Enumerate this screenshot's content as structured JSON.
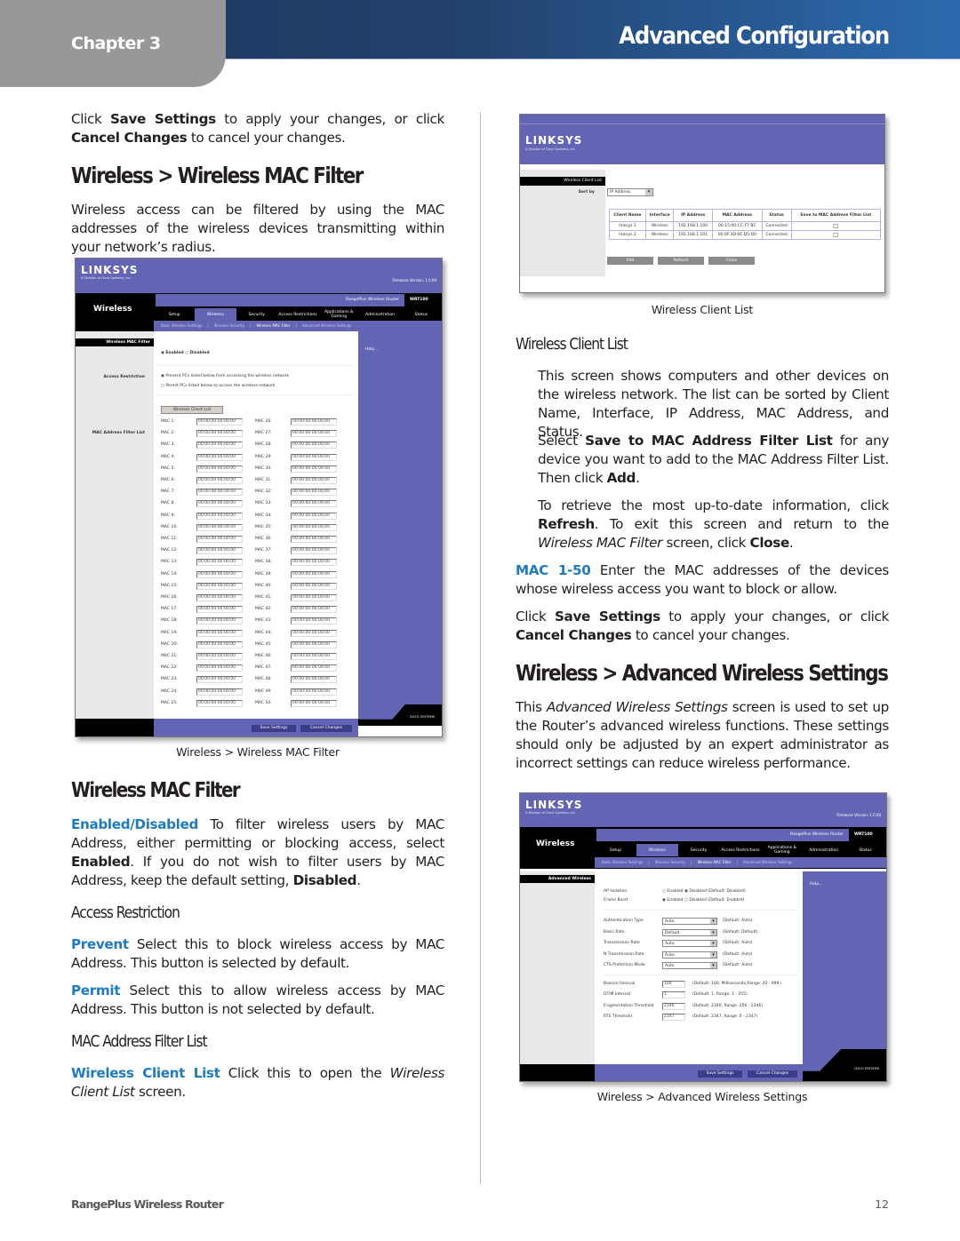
{
  "header": {
    "chapter": "Chapter 3",
    "section": "Advanced Configuration"
  },
  "left": {
    "intro": {
      "pre": "Click ",
      "b1": "Save Settings",
      "mid": " to apply your changes, or click ",
      "b2": "Cancel Changes",
      "post": " to cancel your changes."
    },
    "heading1": "Wireless > Wireless MAC Filter",
    "desc": "Wireless access can be filtered by using the MAC addresses of the wireless devices transmitting within your network’s radius.",
    "caption1": "Wireless > Wireless MAC Filter",
    "heading2": "Wireless MAC Filter",
    "enabled": {
      "term": "Enabled/Disabled",
      "t1": "  To filter wireless users by MAC Address, either permitting or blocking access, select ",
      "b1": "Enabled",
      "t2": ". If you do not wish to filter users by MAC Address, keep the default setting, ",
      "b2": "Disabled",
      "t3": "."
    },
    "sub_access": "Access Restriction",
    "prevent": {
      "term": "Prevent",
      "text": " Select this to block wireless access by MAC Address. This button is selected by default."
    },
    "permit": {
      "term": "Permit",
      "text": " Select this to allow wireless access by MAC Address. This button is not selected by default."
    },
    "sub_maclist": "MAC Address Filter List",
    "wcl": {
      "term": "Wireless Client List",
      "t1": "  Click this to open the ",
      "i": "Wireless Client List",
      "t2": " screen."
    }
  },
  "right": {
    "caption_wcl": "Wireless Client List",
    "sub_wcl": "Wireless Client List",
    "p1": "This screen shows computers and other devices on the wireless network. The list can be sorted by Client Name, Interface, IP Address, MAC Address, and Status.",
    "p2": {
      "t1": "Select ",
      "b1": "Save to MAC Address Filter List",
      "t2": " for any device you want to add to the MAC Address Filter List. Then click ",
      "b2": "Add",
      "t3": "."
    },
    "p3": {
      "t1": "To retrieve the most up-to-date information, click ",
      "b1": "Refresh",
      "t2": ". To exit this screen and return to the ",
      "i": "Wireless MAC Filter",
      "t3": " screen, click ",
      "b2": "Close",
      "t4": "."
    },
    "mac150": {
      "term": "MAC 1-50",
      "text": "  Enter the MAC addresses of the devices whose wireless access you want to block or allow."
    },
    "save": {
      "pre": "Click ",
      "b1": "Save Settings",
      "mid": " to apply your changes, or click ",
      "b2": "Cancel Changes",
      "post": " to cancel your changes."
    },
    "heading": "Wireless > Advanced Wireless Settings",
    "adv_desc": {
      "t1": "This ",
      "i": "Advanced Wireless Settings",
      "t2": " screen is used to set up the Router’s advanced wireless functions. These settings should only be adjusted by an expert administrator as incorrect settings can reduce wireless performance."
    },
    "caption_adv": "Wireless > Advanced Wireless Settings"
  },
  "shot_mac": {
    "logo": "LINKSYS",
    "logo_sub": "A Division of Cisco Systems, Inc.",
    "firmware": "Firmware Version: 1.0.00",
    "section": "Wireless",
    "product": "RangePlus Wireless Router",
    "model": "WRT100",
    "tabs": [
      "Setup",
      "Wireless",
      "Security",
      "Access Restrictions",
      "Applications & Gaming",
      "Administration",
      "Status"
    ],
    "subtabs": [
      "Basic Wireless Settings",
      "|",
      "Wireless Security",
      "|",
      "Wireless MAC Filter",
      "|",
      "Advanced Wireless Settings"
    ],
    "side_title": "Wireless MAC Filter",
    "side_access": "Access Restriction",
    "side_list": "MAC Address Filter List",
    "enabled": "Enabled",
    "disabled": "Disabled",
    "prevent": "Prevent  PCs listed below from accessing the wireless network",
    "permit": "Permit  PCs listed below to access the wireless network",
    "wcl_button": "Wireless Client List",
    "help": "Help...",
    "mac_value": "00:00:00:00:00:00",
    "save": "Save Settings",
    "cancel": "Cancel Changes",
    "cisco": "CISCO SYSTEMS"
  },
  "shot_wcl": {
    "logo": "LINKSYS",
    "logo_sub": "A Division of Cisco Systems, Inc.",
    "side_title": "Wireless Client List",
    "sort_label": "Sort by",
    "sort_value": "IP Address",
    "columns": [
      "Client Name",
      "Interface",
      "IP Address",
      "MAC Address",
      "Status",
      "Save to MAC Address Filter List"
    ],
    "rows": [
      [
        "linksys 1",
        "Wireless",
        "192.168.1.100",
        "00:15:00:CC:F7:BC",
        "Connected"
      ],
      [
        "linksys 2",
        "Wireless",
        "192.168.1.101",
        "00:0F:3D:0E:D5:D0",
        "Connected"
      ]
    ],
    "buttons": [
      "Add",
      "Refresh",
      "Close"
    ]
  },
  "shot_adv": {
    "logo": "LINKSYS",
    "logo_sub": "A Division of Cisco Systems, Inc.",
    "firmware": "Firmware Version: 1.0.00",
    "section": "Wireless",
    "product": "RangePlus Wireless Router",
    "model": "WRT100",
    "tabs": [
      "Setup",
      "Wireless",
      "Security",
      "Access Restrictions",
      "Applications & Gaming",
      "Administration",
      "Status"
    ],
    "subtabs": [
      "Basic Wireless Settings",
      "|",
      "Wireless Security",
      "|",
      "Wireless MAC Filter",
      "|",
      "Advanced Wireless Settings"
    ],
    "side_title": "Advanced Wireless",
    "help": "Help...",
    "radios": [
      {
        "label": "AP Isolation",
        "opt1": "Enabled",
        "opt2": "Disabled (Default: Disabled)"
      },
      {
        "label": "Frame Burst",
        "opt1": "Enabled",
        "opt2": "Disabled (Default: Enabled)"
      }
    ],
    "selects": [
      {
        "label": "Authentication Type",
        "value": "Auto",
        "default": "(Default: Auto)"
      },
      {
        "label": "Basic Rate",
        "value": "Default",
        "default": "(Default: Default)"
      },
      {
        "label": "Transmission Rate",
        "value": "Auto",
        "default": "(Default: Auto)"
      },
      {
        "label": "N Transmission Rate",
        "value": "Auto",
        "default": "(Default: Auto)"
      },
      {
        "label": "CTS Protection Mode",
        "value": "Auto",
        "default": "(Default: Auto)"
      }
    ],
    "inputs": [
      {
        "label": "Beacon Interval",
        "value": "100",
        "hint": "(Default: 100, Milliseconds,Range: 20 - 999 )"
      },
      {
        "label": "DTIM Interval",
        "value": "1",
        "hint": "(Default: 1, Range: 1 - 255)"
      },
      {
        "label": "Fragmentation Threshold",
        "value": "2346",
        "hint": "(Default: 2346, Range: 256 - 2346)"
      },
      {
        "label": "RTS Threshold",
        "value": "2347",
        "hint": "(Default: 2347, Range: 0 - 2347)"
      }
    ],
    "save": "Save Settings",
    "cancel": "Cancel Changes",
    "cisco": "CISCO SYSTEMS"
  },
  "footer": {
    "product": "RangePlus Wireless Router",
    "page": "12"
  }
}
